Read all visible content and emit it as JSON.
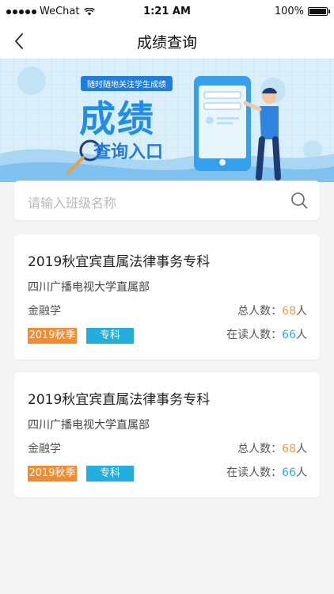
{
  "status_bar": {
    "carrier": "WeChat",
    "time": "1:21 AM",
    "battery": "100%"
  },
  "nav": {
    "title": "成绩查询"
  },
  "banner": {
    "tag": "随时随地关注学生成绩",
    "headline": "成绩",
    "subline": "查询入口"
  },
  "search": {
    "placeholder": "请输入班级名称"
  },
  "cards": [
    {
      "title": "2019秋宜宾直属法律事务专科",
      "school": "四川广播电视大学直属部",
      "major": "金融学",
      "total_label": "总人数：",
      "total_value": "68",
      "total_unit": "人",
      "reading_label": "在读人数：",
      "reading_value": "66",
      "reading_unit": "人",
      "season_tag": "2019秋季",
      "level_tag": "专科"
    },
    {
      "title": "2019秋宜宾直属法律事务专科",
      "school": "四川广播电视大学直属部",
      "major": "金融学",
      "total_label": "总人数：",
      "total_value": "68",
      "total_unit": "人",
      "reading_label": "在读人数：",
      "reading_value": "66",
      "reading_unit": "人",
      "season_tag": "2019秋季",
      "level_tag": "专科"
    }
  ],
  "colors": {
    "accent_blue": "#23aee0",
    "accent_orange": "#f18c2e"
  }
}
